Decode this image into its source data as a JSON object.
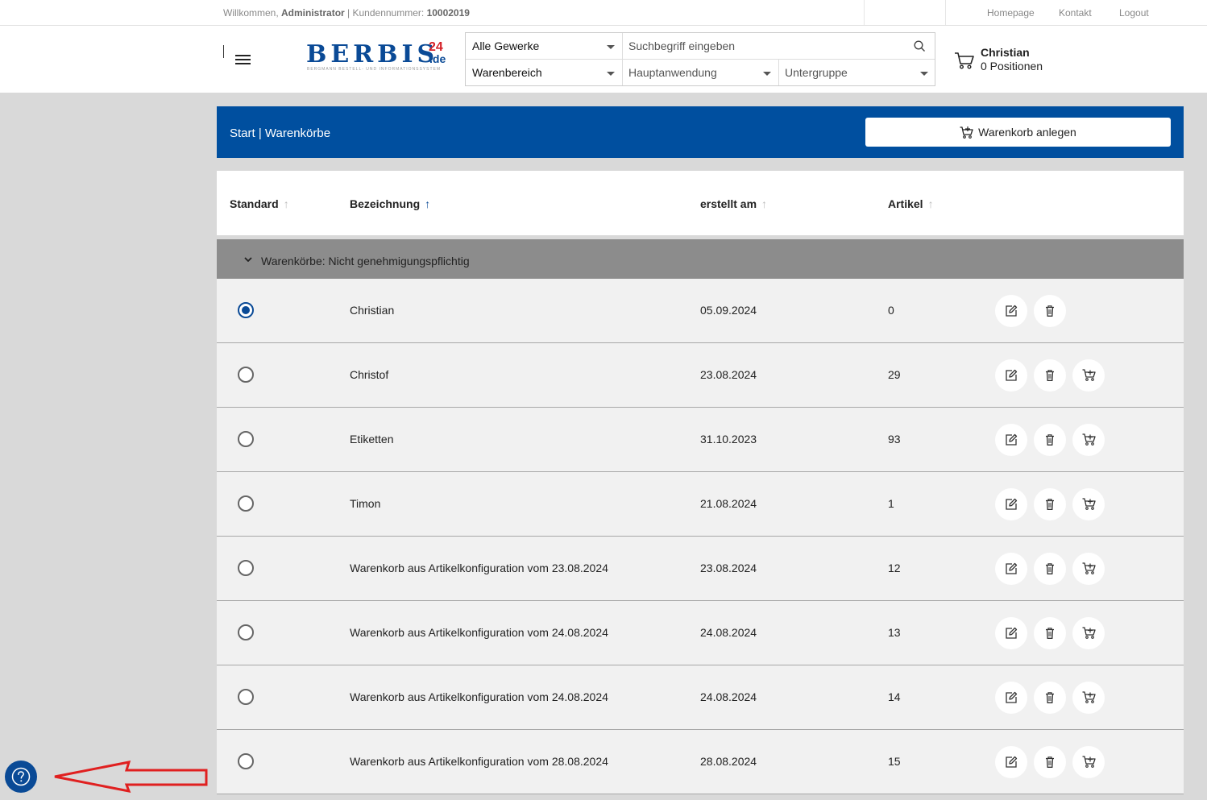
{
  "topbar": {
    "welcome_prefix": "Willkommen,",
    "user": "Administrator",
    "customer_label": "| Kundennummer:",
    "customer_number": "10002019",
    "links": [
      "Homepage",
      "Kontakt",
      "Logout"
    ]
  },
  "header": {
    "logo_main": "BERBIS",
    "logo_24": "24",
    "logo_de": ".de",
    "logo_sub": "BERGMANN BESTELL- UND INFORMATIONSSYSTEM",
    "select_gewerke": "Alle Gewerke",
    "search_placeholder": "Suchbegriff eingeben",
    "select_warenbereich": "Warenbereich",
    "select_hauptanwendung": "Hauptanwendung",
    "select_untergruppe": "Untergruppe",
    "cart_name": "Christian",
    "cart_positions": "0 Positionen"
  },
  "breadcrumb": "Start | Warenkörbe",
  "new_cart_label": "Warenkorb anlegen",
  "columns": {
    "standard": "Standard",
    "bezeichnung": "Bezeichnung",
    "erstellt": "erstellt am",
    "artikel": "Artikel"
  },
  "group_label": "Warenkörbe: Nicht genehmigungspflichtig",
  "rows": [
    {
      "name": "Christian",
      "date": "05.09.2024",
      "count": "0",
      "selected": true,
      "order": false
    },
    {
      "name": "Christof",
      "date": "23.08.2024",
      "count": "29",
      "selected": false,
      "order": true
    },
    {
      "name": "Etiketten",
      "date": "31.10.2023",
      "count": "93",
      "selected": false,
      "order": true
    },
    {
      "name": "Timon",
      "date": "21.08.2024",
      "count": "1",
      "selected": false,
      "order": true
    },
    {
      "name": "Warenkorb aus Artikelkonfiguration vom 23.08.2024",
      "date": "23.08.2024",
      "count": "12",
      "selected": false,
      "order": true
    },
    {
      "name": "Warenkorb aus Artikelkonfiguration vom 24.08.2024",
      "date": "24.08.2024",
      "count": "13",
      "selected": false,
      "order": true
    },
    {
      "name": "Warenkorb aus Artikelkonfiguration vom 24.08.2024",
      "date": "24.08.2024",
      "count": "14",
      "selected": false,
      "order": true
    },
    {
      "name": "Warenkorb aus Artikelkonfiguration vom 28.08.2024",
      "date": "28.08.2024",
      "count": "15",
      "selected": false,
      "order": true
    }
  ],
  "colors": {
    "brand_blue": "#004f9f",
    "annotation_red": "#e02020"
  }
}
